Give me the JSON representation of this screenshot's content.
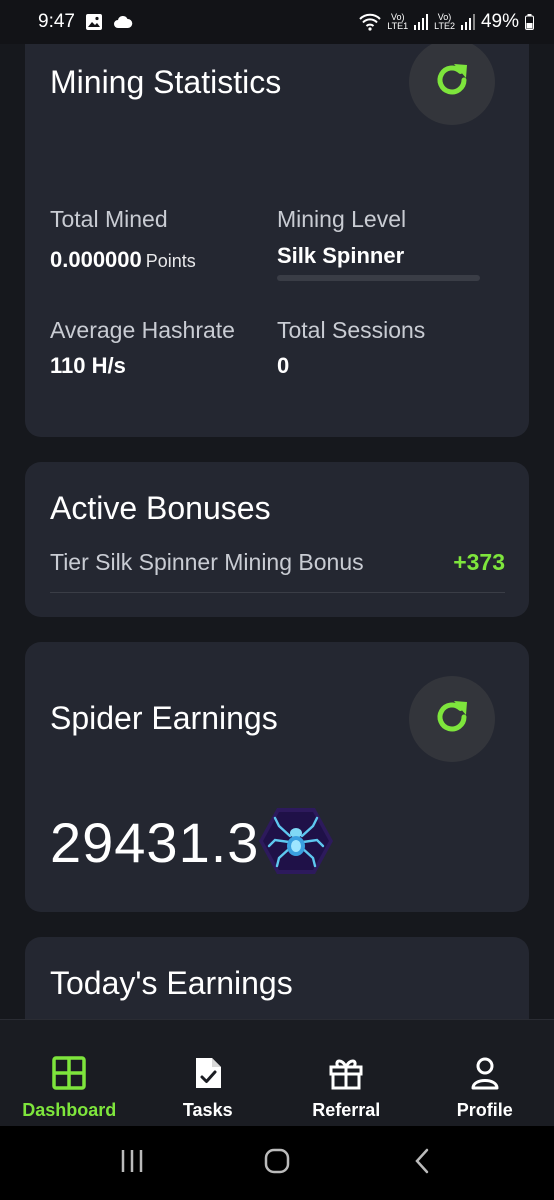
{
  "status_bar": {
    "time": "9:47",
    "battery": "49%",
    "sim1_label_top": "Vo)",
    "sim1_label_bottom": "LTE1",
    "sim2_label_top": "Vo)",
    "sim2_label_bottom": "LTE2",
    "icons": [
      "image-icon",
      "cloud-icon",
      "wifi-icon",
      "signal-icon",
      "battery-icon"
    ]
  },
  "mining_statistics": {
    "title": "Mining Statistics",
    "total_mined_label": "Total Mined",
    "total_mined_value": "0.000000",
    "total_mined_unit": "Points",
    "mining_level_label": "Mining Level",
    "mining_level_value": "Silk Spinner",
    "mining_level_progress": 0,
    "avg_hashrate_label": "Average Hashrate",
    "avg_hashrate_value": "110 H/s",
    "total_sessions_label": "Total Sessions",
    "total_sessions_value": "0"
  },
  "active_bonuses": {
    "title": "Active Bonuses",
    "items": [
      {
        "name": "Tier Silk Spinner Mining Bonus",
        "value": "+373"
      }
    ]
  },
  "spider_earnings": {
    "title": "Spider Earnings",
    "amount": "29431.3"
  },
  "todays_earnings": {
    "title": "Today's Earnings"
  },
  "bottom_nav": {
    "items": [
      {
        "label": "Dashboard",
        "icon": "grid-icon",
        "active": true
      },
      {
        "label": "Tasks",
        "icon": "task-document-icon",
        "active": false
      },
      {
        "label": "Referral",
        "icon": "gift-icon",
        "active": false
      },
      {
        "label": "Profile",
        "icon": "person-icon",
        "active": false
      }
    ]
  },
  "colors": {
    "accent": "#7ee53c",
    "card": "#242731",
    "background": "#16181d"
  }
}
